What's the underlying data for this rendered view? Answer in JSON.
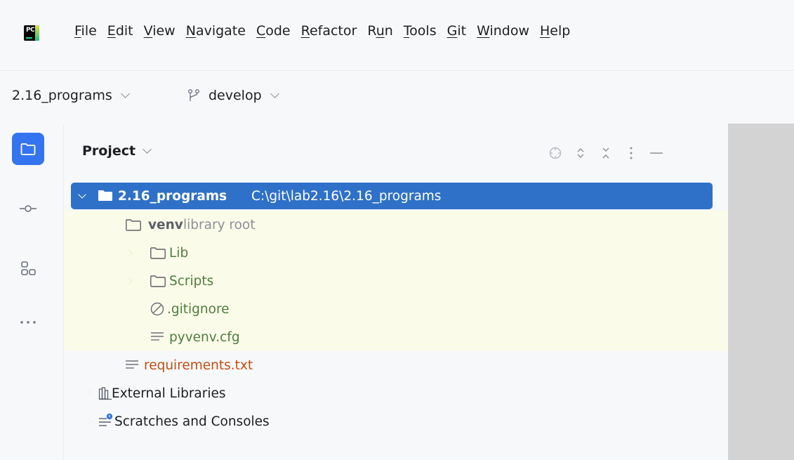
{
  "menubar": {
    "logo_text": "PC",
    "items": [
      {
        "mnemonic": "F",
        "rest": "ile"
      },
      {
        "mnemonic": "E",
        "rest": "dit"
      },
      {
        "mnemonic": "V",
        "rest": "iew"
      },
      {
        "mnemonic": "N",
        "rest": "avigate"
      },
      {
        "mnemonic": "C",
        "rest": "ode"
      },
      {
        "mnemonic": "R",
        "rest": "efactor"
      },
      {
        "pre": "R",
        "mnemonic": "u",
        "rest": "n"
      },
      {
        "mnemonic": "T",
        "rest": "ools"
      },
      {
        "mnemonic": "G",
        "rest": "it"
      },
      {
        "mnemonic": "W",
        "rest": "indow"
      },
      {
        "mnemonic": "H",
        "rest": "elp"
      }
    ]
  },
  "toolbar": {
    "project_name": "2.16_programs",
    "branch_name": "develop"
  },
  "panel": {
    "title": "Project"
  },
  "tree": {
    "root": {
      "name": "2.16_programs",
      "path": "C:\\git\\lab2.16\\2.16_programs"
    },
    "venv": {
      "name": "venv",
      "hint": "library root"
    },
    "lib": {
      "name": "Lib"
    },
    "scripts": {
      "name": "Scripts"
    },
    "gitignore": {
      "name": ".gitignore"
    },
    "pyvenv": {
      "name": "pyvenv.cfg"
    },
    "requirements": {
      "name": "requirements.txt"
    },
    "external": {
      "name": "External Libraries"
    },
    "scratches": {
      "name": "Scratches and Consoles"
    }
  },
  "colors": {
    "selection": "#2f71c8",
    "active_tool": "#3574f0",
    "library_band": "#fbfbe9",
    "unversioned": "#c24e13",
    "excluded": "#4f7f40"
  }
}
